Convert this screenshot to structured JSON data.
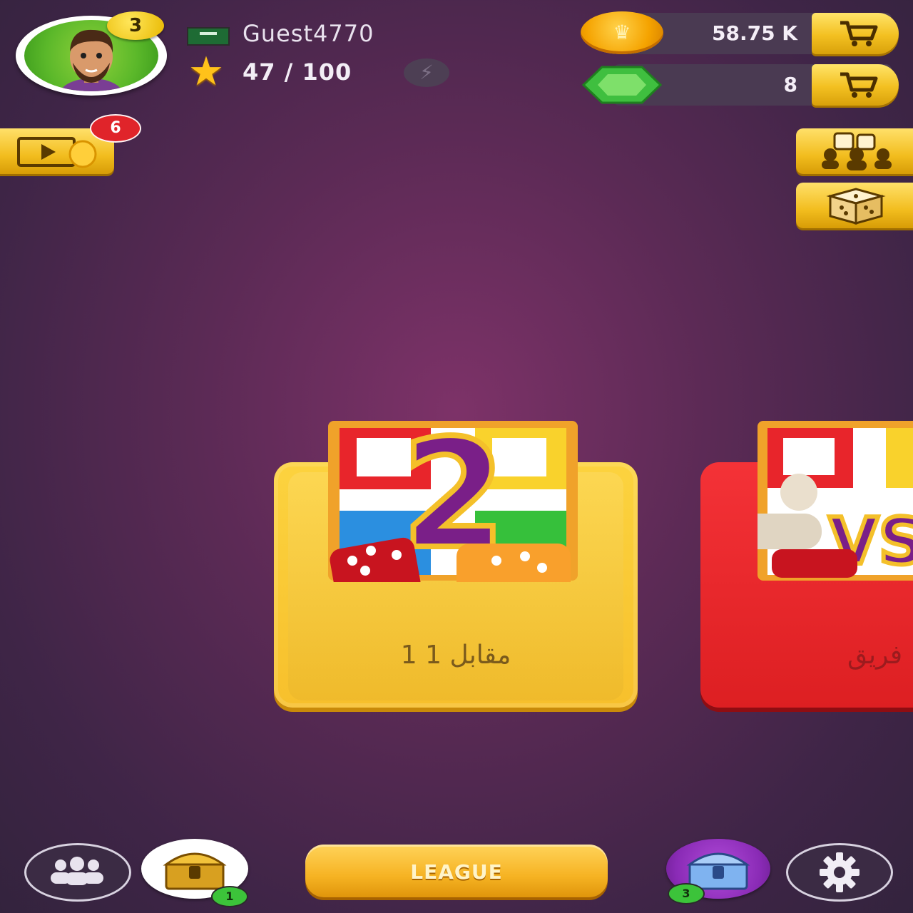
{
  "player": {
    "level": "3",
    "name": "Guest4770",
    "xp": "47 / 100"
  },
  "currency": {
    "coins": "58.75 K",
    "gems": "8"
  },
  "badges": {
    "video_rewards": "6",
    "chest_count": "1",
    "premium_chest_count": "3"
  },
  "modes": [
    {
      "label": "1 مقابل 1",
      "color": "#f7c02c"
    },
    {
      "label": "فريق",
      "color": "#dd1f22"
    }
  ],
  "bottom": {
    "league_label": "LEAGUE"
  },
  "icons": {
    "profile": "avatar",
    "flag": "flag-icon",
    "star": "star-icon",
    "bolt": "lightning-icon",
    "coin": "coin-icon",
    "gem": "gem-icon",
    "cart": "cart-icon",
    "video": "video-reward-icon",
    "dice_group": "dice-group-icon",
    "dice": "dice-icon",
    "friends": "friends-icon",
    "chest": "treasure-chest-icon",
    "settings": "gear-icon"
  }
}
